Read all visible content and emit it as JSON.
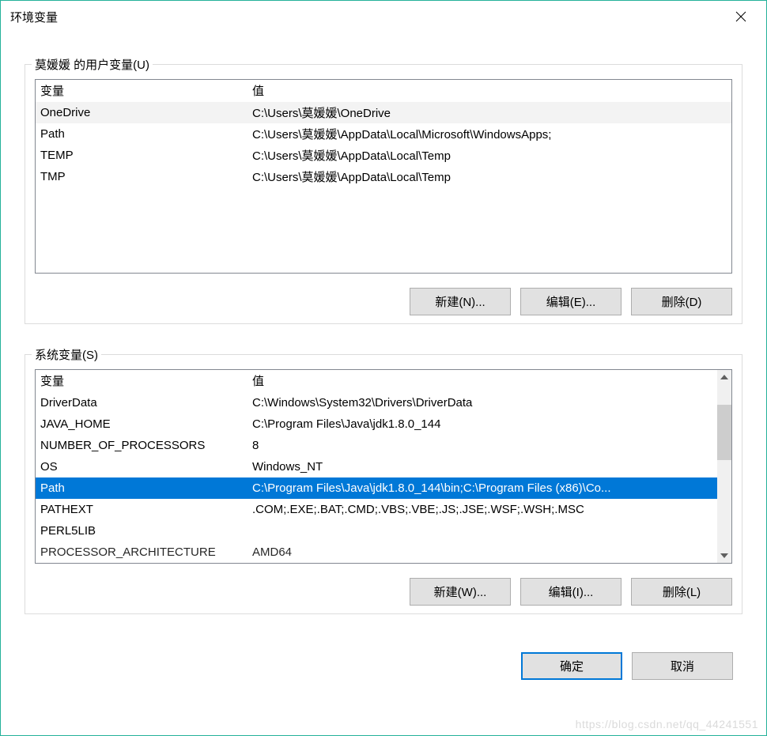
{
  "window": {
    "title": "环境变量"
  },
  "userVars": {
    "label": "莫媛媛 的用户变量(U)",
    "headers": {
      "var": "变量",
      "val": "值"
    },
    "rows": [
      {
        "var": "OneDrive",
        "val": "C:\\Users\\莫媛媛\\OneDrive",
        "highlight": true
      },
      {
        "var": "Path",
        "val": "C:\\Users\\莫媛媛\\AppData\\Local\\Microsoft\\WindowsApps;"
      },
      {
        "var": "TEMP",
        "val": "C:\\Users\\莫媛媛\\AppData\\Local\\Temp"
      },
      {
        "var": "TMP",
        "val": "C:\\Users\\莫媛媛\\AppData\\Local\\Temp"
      }
    ],
    "buttons": {
      "new": "新建(N)...",
      "edit": "编辑(E)...",
      "delete": "删除(D)"
    }
  },
  "sysVars": {
    "label": "系统变量(S)",
    "headers": {
      "var": "变量",
      "val": "值"
    },
    "rows": [
      {
        "var": "DriverData",
        "val": "C:\\Windows\\System32\\Drivers\\DriverData"
      },
      {
        "var": "JAVA_HOME",
        "val": "C:\\Program Files\\Java\\jdk1.8.0_144"
      },
      {
        "var": "NUMBER_OF_PROCESSORS",
        "val": "8"
      },
      {
        "var": "OS",
        "val": "Windows_NT"
      },
      {
        "var": "Path",
        "val": "C:\\Program Files\\Java\\jdk1.8.0_144\\bin;C:\\Program Files (x86)\\Co...",
        "selected": true
      },
      {
        "var": "PATHEXT",
        "val": ".COM;.EXE;.BAT;.CMD;.VBS;.VBE;.JS;.JSE;.WSF;.WSH;.MSC"
      },
      {
        "var": "PERL5LIB",
        "val": ""
      },
      {
        "var": "PROCESSOR_ARCHITECTURE",
        "val": "AMD64"
      }
    ],
    "buttons": {
      "new": "新建(W)...",
      "edit": "编辑(I)...",
      "delete": "删除(L)"
    }
  },
  "dialog": {
    "ok": "确定",
    "cancel": "取消"
  },
  "watermark": "https://blog.csdn.net/qq_44241551"
}
